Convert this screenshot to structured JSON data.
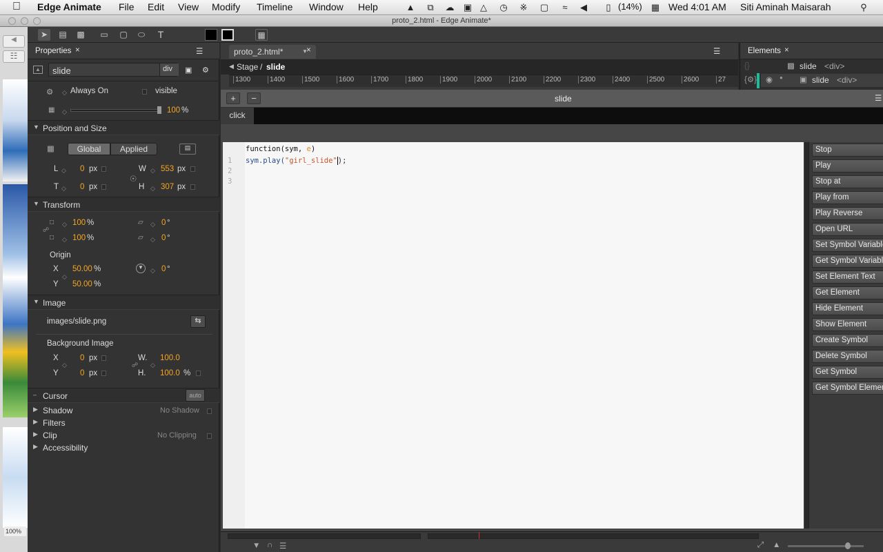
{
  "menubar": {
    "app_name": "Edge Animate",
    "menus": [
      "File",
      "Edit",
      "View",
      "Modify",
      "Timeline",
      "Window",
      "Help"
    ],
    "battery": "(14%)",
    "clock": "Wed 4:01 AM",
    "user": "Siti Aminah Maisarah"
  },
  "window": {
    "title": "proto_2.html - Edge Animate*"
  },
  "properties": {
    "panel_title": "Properties",
    "element_name": "slide",
    "element_type": "div",
    "always_on": "Always On",
    "visible": "visible",
    "opacity": "100",
    "opacity_unit": "%",
    "position_size": {
      "title": "Position and Size",
      "global": "Global",
      "applied": "Applied",
      "L_label": "L",
      "L": "0",
      "L_unit": "px",
      "T_label": "T",
      "T": "0",
      "T_unit": "px",
      "W_label": "W",
      "W": "553",
      "W_unit": "px",
      "H_label": "H",
      "H": "307",
      "H_unit": "px"
    },
    "transform": {
      "title": "Transform",
      "scale_x": "100",
      "scale_y": "100",
      "pct": "%",
      "skew_x": "0",
      "skew_y": "0",
      "deg": "°",
      "origin_title": "Origin",
      "X_label": "X",
      "origin_x": "50.00",
      "Y_label": "Y",
      "origin_y": "50.00",
      "rotation": "0"
    },
    "image": {
      "title": "Image",
      "path": "images/slide.png",
      "bg_title": "Background Image",
      "X_label": "X",
      "bg_x": "0",
      "bg_x_unit": "px",
      "Y_label": "Y",
      "bg_y": "0",
      "bg_y_unit": "px",
      "W_label": "W.",
      "bg_w": "100.0",
      "H_label": "H.",
      "bg_h": "100.0",
      "bg_h_unit": "%"
    },
    "cursor": {
      "title": "Cursor",
      "value": "auto"
    },
    "shadow": {
      "title": "Shadow",
      "value": "No Shadow"
    },
    "filters": {
      "title": "Filters"
    },
    "clip": {
      "title": "Clip",
      "value": "No Clipping"
    },
    "accessibility": {
      "title": "Accessibility"
    }
  },
  "stage": {
    "tab_label": "proto_2.html*",
    "breadcrumb_root": "Stage",
    "breadcrumb_sep": "/",
    "breadcrumb_current": "slide",
    "ruler_ticks": [
      "1300",
      "1400",
      "1500",
      "1600",
      "1700",
      "1800",
      "1900",
      "2000",
      "2100",
      "2200",
      "2300",
      "2400",
      "2500",
      "2600",
      "27"
    ]
  },
  "elements_panel": {
    "title": "Elements",
    "rows": [
      {
        "name": "slide",
        "tag": "<div>"
      },
      {
        "name": "slide",
        "tag": "<div>"
      }
    ]
  },
  "code": {
    "title": "slide",
    "event_tab": "click",
    "signature_prefix": "function(sym, ",
    "signature_param": "e",
    "signature_suffix": ")",
    "lines": [
      {
        "num": "1",
        "pre": "sym.play(",
        "str": "\"girl_slide\"",
        "post": ");"
      },
      {
        "num": "2",
        "pre": "",
        "str": "",
        "post": ""
      },
      {
        "num": "3",
        "pre": "",
        "str": "",
        "post": ""
      }
    ]
  },
  "snippets": [
    "Stop",
    "Play",
    "Stop at",
    "Play from",
    "Play Reverse",
    "Open URL",
    "Set Symbol Variable",
    "Get Symbol Variable",
    "Set Element Text",
    "Get Element",
    "Hide Element",
    "Show Element",
    "Create Symbol",
    "Delete Symbol",
    "Get Symbol",
    "Get Symbol Element"
  ],
  "zoom_left": "100%"
}
